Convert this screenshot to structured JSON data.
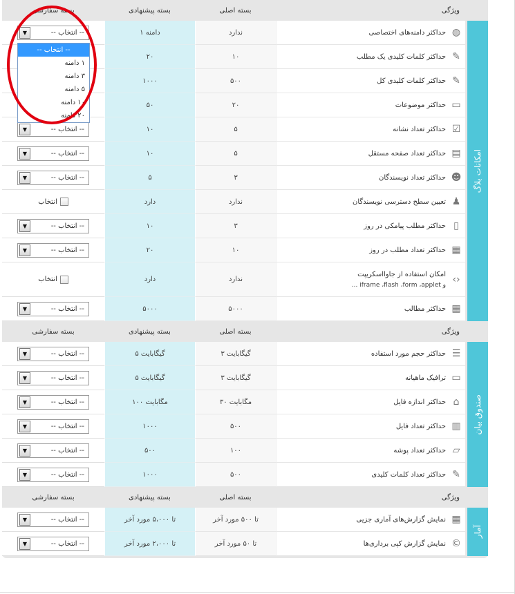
{
  "header": {
    "custom": "بسته سفارشی",
    "suggested": "بسته پیشنهادی",
    "base": "بسته اصلی",
    "feature": "ویژگی"
  },
  "select_default": "-- انتخاب --",
  "checkbox_label": "انتخاب",
  "dropdown": {
    "options": [
      "-- انتخاب --",
      "۱ دامنه",
      "۳ دامنه",
      "۵ دامنه",
      "۱۰ دامنه",
      "۲۰ دامنه"
    ],
    "selected_index": 0
  },
  "sections": [
    {
      "title": "امکانات بلاگ",
      "rows": [
        {
          "feature": "حداکثر دامنه‌های اختصاصی",
          "icon": "globe-icon",
          "base": "ندارد",
          "suggested": "۱ دامنه",
          "control": "select",
          "current": "-- انتخاب --"
        },
        {
          "feature": "حداکثر کلمات کلیدی یک مطلب",
          "icon": "tag-icon",
          "base": "۱۰",
          "suggested": "۲۰",
          "control": "select",
          "current": "-- انتخاب --"
        },
        {
          "feature": "حداکثر کلمات کلیدی کل",
          "icon": "tags-icon",
          "base": "۵۰۰",
          "suggested": "۱۰۰۰",
          "control": "select",
          "current": "-- انتخاب --"
        },
        {
          "feature": "حداکثر موضوعات",
          "icon": "folder-icon",
          "base": "۲۰",
          "suggested": "۵۰",
          "control": "select",
          "current": "-- انتخاب --"
        },
        {
          "feature": "حداکثر تعداد نشانه",
          "icon": "bookmark-icon",
          "base": "۵",
          "suggested": "۱۰",
          "control": "select",
          "current": "-- انتخاب --"
        },
        {
          "feature": "حداکثر تعداد صفحه مستقل",
          "icon": "page-icon",
          "base": "۵",
          "suggested": "۱۰",
          "control": "select",
          "current": "-- انتخاب --"
        },
        {
          "feature": "حداکثر تعداد نویسندگان",
          "icon": "users-icon",
          "base": "۳",
          "suggested": "۵",
          "control": "select",
          "current": "-- انتخاب --"
        },
        {
          "feature": "تعیین سطح دسترسی نویسندگان",
          "icon": "user-key-icon",
          "base": "ندارد",
          "suggested": "دارد",
          "control": "checkbox"
        },
        {
          "feature": "حداکثر مطلب پیامکی در روز",
          "icon": "mobile-icon",
          "base": "۳",
          "suggested": "۱۰",
          "control": "select",
          "current": "-- انتخاب --"
        },
        {
          "feature": "حداکثر تعداد مطلب در روز",
          "icon": "posts-icon",
          "base": "۱۰",
          "suggested": "۲۰",
          "control": "select",
          "current": "-- انتخاب --"
        },
        {
          "feature": "امکان استفاده از جاوااسکریپت",
          "sub": "و iframe ،flash ،form ،applet ...",
          "icon": "code-icon",
          "base": "ندارد",
          "suggested": "دارد",
          "control": "checkbox",
          "tall": true
        },
        {
          "feature": "حداکثر مطالب",
          "icon": "posts-icon",
          "base": "۵۰۰۰",
          "suggested": "۵۰۰۰",
          "control": "select",
          "current": "-- انتخاب --"
        }
      ]
    },
    {
      "title": "صندوق بیان",
      "rows": [
        {
          "feature": "حداکثر حجم مورد استفاده",
          "icon": "database-icon",
          "base": "۳ گیگابایت",
          "suggested": "۵ گیگابایت",
          "control": "select",
          "current": "-- انتخاب --"
        },
        {
          "feature": "ترافیک ماهیانه",
          "icon": "monitor-icon",
          "base": "۳ گیگابایت",
          "suggested": "۵ گیگابایت",
          "control": "select",
          "current": "-- انتخاب --"
        },
        {
          "feature": "حداکثر اندازه فایل",
          "icon": "file-size-icon",
          "base": "۳۰ مگابایت",
          "suggested": "۱۰۰ مگابایت",
          "control": "select",
          "current": "-- انتخاب --"
        },
        {
          "feature": "حداکثر تعداد فایل",
          "icon": "files-icon",
          "base": "۵۰۰",
          "suggested": "۱۰۰۰",
          "control": "select",
          "current": "-- انتخاب --"
        },
        {
          "feature": "حداکثر تعداد پوشه",
          "icon": "folder-outline-icon",
          "base": "۱۰۰",
          "suggested": "۵۰۰",
          "control": "select",
          "current": "-- انتخاب --"
        },
        {
          "feature": "حداکثر تعداد کلمات کلیدی",
          "icon": "tags-icon",
          "base": "۵۰۰",
          "suggested": "۱۰۰۰",
          "control": "select",
          "current": "-- انتخاب --"
        }
      ]
    },
    {
      "title": "آمار",
      "rows": [
        {
          "feature": "نمایش گزارش‌های آماری جزیی",
          "icon": "calendar-icon",
          "base": "تا ۵۰۰ مورد آخر",
          "suggested": "تا ۵،۰۰۰ مورد آخر",
          "control": "select",
          "current": "-- انتخاب --"
        },
        {
          "feature": "نمایش گزارش کپی برداری‌ها",
          "icon": "copyright-icon",
          "base": "تا ۵۰ مورد آخر",
          "suggested": "تا ۲،۰۰۰ مورد آخر",
          "control": "select",
          "current": "-- انتخاب --"
        }
      ]
    }
  ]
}
